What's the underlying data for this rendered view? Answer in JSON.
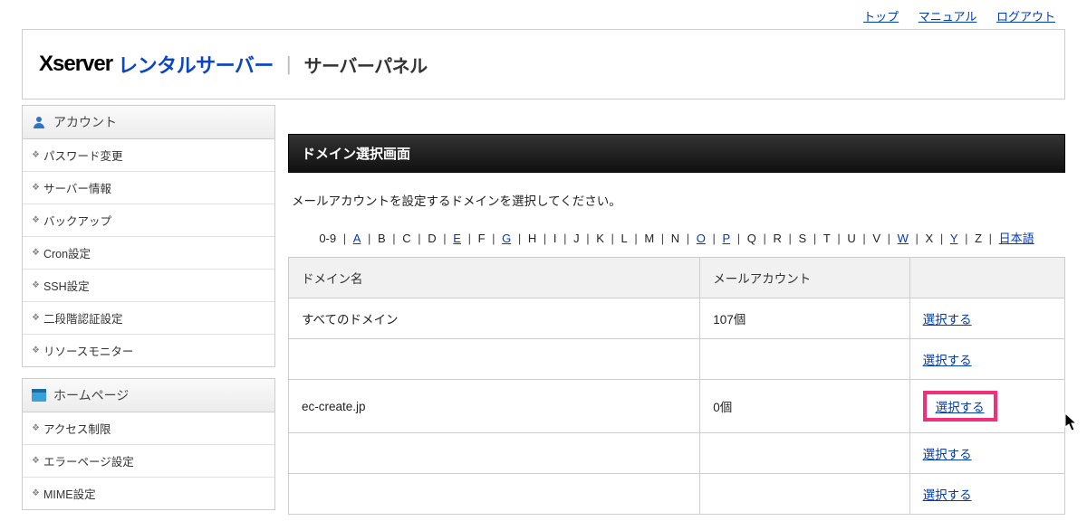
{
  "topnav": {
    "top": "トップ",
    "manual": "マニュアル",
    "logout": "ログアウト"
  },
  "logo": {
    "brand": "Xserver",
    "rental": "レンタルサーバー",
    "panel": "サーバーパネル"
  },
  "sidebar": {
    "section1_title": "アカウント",
    "section1_items": [
      "パスワード変更",
      "サーバー情報",
      "バックアップ",
      "Cron設定",
      "SSH設定",
      "二段階認証設定",
      "リソースモニター"
    ],
    "section2_title": "ホームページ",
    "section2_items": [
      "アクセス制限",
      "エラーページ設定",
      "MIME設定"
    ]
  },
  "main": {
    "title": "ドメイン選択画面",
    "desc": "メールアカウントを設定するドメインを選択してください。",
    "az_digits": "0-9",
    "az": [
      {
        "t": "A",
        "l": true
      },
      {
        "t": "B"
      },
      {
        "t": "C"
      },
      {
        "t": "D"
      },
      {
        "t": "E",
        "l": true
      },
      {
        "t": "F"
      },
      {
        "t": "G",
        "l": true
      },
      {
        "t": "H"
      },
      {
        "t": "I"
      },
      {
        "t": "J"
      },
      {
        "t": "K"
      },
      {
        "t": "L"
      },
      {
        "t": "M"
      },
      {
        "t": "N"
      },
      {
        "t": "O",
        "l": true
      },
      {
        "t": "P",
        "l": true
      },
      {
        "t": "Q"
      },
      {
        "t": "R"
      },
      {
        "t": "S"
      },
      {
        "t": "T"
      },
      {
        "t": "U"
      },
      {
        "t": "V"
      },
      {
        "t": "W",
        "l": true
      },
      {
        "t": "X"
      },
      {
        "t": "Y",
        "l": true
      },
      {
        "t": "Z"
      }
    ],
    "az_jp": "日本語",
    "th_domain": "ドメイン名",
    "th_mail": "メールアカウント",
    "select_label": "選択する",
    "rows": [
      {
        "domain": "すべてのドメイン",
        "mail": "107個",
        "select": "選択する",
        "hl": false
      },
      {
        "domain": "",
        "mail": "",
        "select": "選択する",
        "hl": false
      },
      {
        "domain": "ec-create.jp",
        "mail": "0個",
        "select": "選択する",
        "hl": true
      },
      {
        "domain": "",
        "mail": "",
        "select": "選択する",
        "hl": false
      },
      {
        "domain": "",
        "mail": "",
        "select": "選択する",
        "hl": false
      }
    ]
  }
}
